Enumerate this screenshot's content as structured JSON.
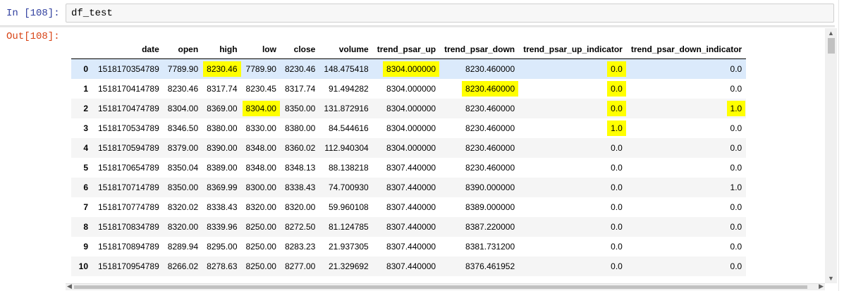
{
  "input_cell": {
    "prompt": "In [108]:",
    "code": "df_test"
  },
  "output_cell": {
    "prompt": "Out[108]:"
  },
  "table": {
    "columns": [
      "",
      "date",
      "open",
      "high",
      "low",
      "close",
      "volume",
      "trend_psar_up",
      "trend_psar_down",
      "trend_psar_up_indicator",
      "trend_psar_down_indicator"
    ],
    "rows": [
      [
        "0",
        "1518170354789",
        "7789.90",
        "8230.46",
        "7789.90",
        "8230.46",
        "148.475418",
        "8304.000000",
        "8230.460000",
        "0.0",
        "0.0"
      ],
      [
        "1",
        "1518170414789",
        "8230.46",
        "8317.74",
        "8230.45",
        "8317.74",
        "91.494282",
        "8304.000000",
        "8230.460000",
        "0.0",
        "0.0"
      ],
      [
        "2",
        "1518170474789",
        "8304.00",
        "8369.00",
        "8304.00",
        "8350.00",
        "131.872916",
        "8304.000000",
        "8230.460000",
        "0.0",
        "1.0"
      ],
      [
        "3",
        "1518170534789",
        "8346.50",
        "8380.00",
        "8330.00",
        "8380.00",
        "84.544616",
        "8304.000000",
        "8230.460000",
        "1.0",
        "0.0"
      ],
      [
        "4",
        "1518170594789",
        "8379.00",
        "8390.00",
        "8348.00",
        "8360.02",
        "112.940304",
        "8304.000000",
        "8230.460000",
        "0.0",
        "0.0"
      ],
      [
        "5",
        "1518170654789",
        "8350.04",
        "8389.00",
        "8348.00",
        "8348.13",
        "88.138218",
        "8307.440000",
        "8230.460000",
        "0.0",
        "0.0"
      ],
      [
        "6",
        "1518170714789",
        "8350.00",
        "8369.99",
        "8300.00",
        "8338.43",
        "74.700930",
        "8307.440000",
        "8390.000000",
        "0.0",
        "1.0"
      ],
      [
        "7",
        "1518170774789",
        "8320.02",
        "8338.43",
        "8320.00",
        "8320.00",
        "59.960108",
        "8307.440000",
        "8389.000000",
        "0.0",
        "0.0"
      ],
      [
        "8",
        "1518170834789",
        "8320.00",
        "8339.96",
        "8250.00",
        "8272.50",
        "81.124785",
        "8307.440000",
        "8387.220000",
        "0.0",
        "0.0"
      ],
      [
        "9",
        "1518170894789",
        "8289.94",
        "8295.00",
        "8250.00",
        "8283.23",
        "21.937305",
        "8307.440000",
        "8381.731200",
        "0.0",
        "0.0"
      ],
      [
        "10",
        "1518170954789",
        "8266.02",
        "8278.63",
        "8250.00",
        "8277.00",
        "21.329692",
        "8307.440000",
        "8376.461952",
        "0.0",
        "0.0"
      ]
    ],
    "highlights": [
      [
        0,
        3
      ],
      [
        0,
        7
      ],
      [
        0,
        9
      ],
      [
        1,
        8
      ],
      [
        1,
        9
      ],
      [
        2,
        4
      ],
      [
        2,
        9
      ],
      [
        2,
        10
      ],
      [
        3,
        9
      ]
    ],
    "hovered_row": 0,
    "highlight_color": "#ffff00"
  },
  "scrollbars": {
    "up_icon": "▲",
    "down_icon": "▼",
    "left_icon": "◀",
    "right_icon": "▶"
  }
}
